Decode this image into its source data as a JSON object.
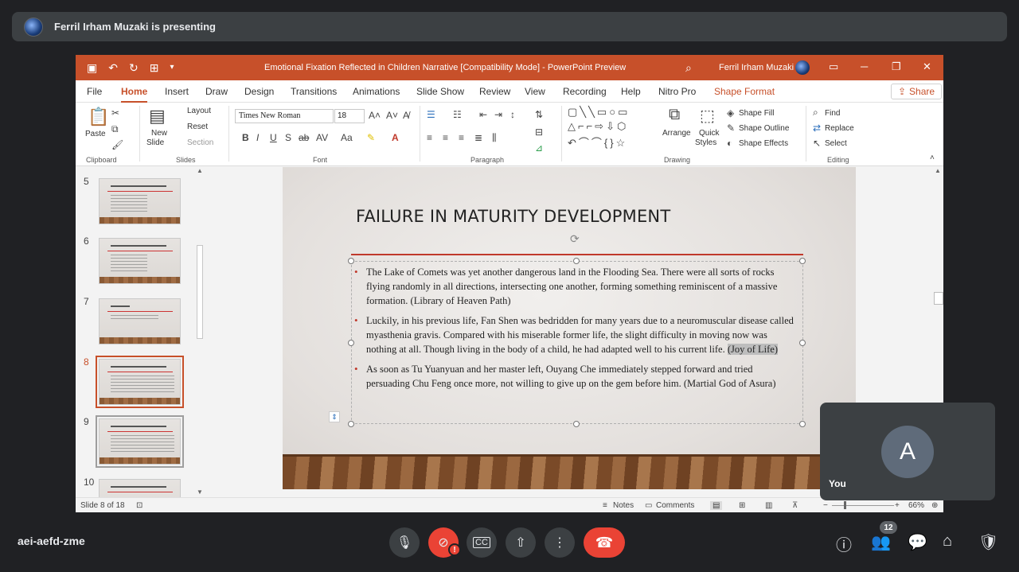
{
  "meet": {
    "presenter_banner": "Ferril Irham Muzaki is presenting",
    "meeting_code": "aei-aefd-zme",
    "self_avatar_letter": "A",
    "self_label": "You",
    "participants_count": "12",
    "alert_badge": "!"
  },
  "ppt": {
    "window_title": "Emotional Fixation Reflected in Children Narrative [Compatibility Mode] - PowerPoint Preview",
    "user_name": "Ferril Irham Muzaki",
    "tabs": [
      "File",
      "Home",
      "Insert",
      "Draw",
      "Design",
      "Transitions",
      "Animations",
      "Slide Show",
      "Review",
      "View",
      "Recording",
      "Help",
      "Nitro Pro",
      "Shape Format"
    ],
    "share_label": "Share",
    "ribbon": {
      "paste": "Paste",
      "new_slide_1": "New",
      "new_slide_2": "Slide",
      "layout": "Layout",
      "reset": "Reset",
      "section": "Section",
      "font_name": "Times New Roman",
      "font_size": "18",
      "arrange": "Arrange",
      "quick_styles_1": "Quick",
      "quick_styles_2": "Styles",
      "shape_fill": "Shape Fill",
      "shape_outline": "Shape Outline",
      "shape_effects": "Shape Effects",
      "find": "Find",
      "replace": "Replace",
      "select": "Select",
      "groups": {
        "clipboard": "Clipboard",
        "slides": "Slides",
        "font": "Font",
        "paragraph": "Paragraph",
        "drawing": "Drawing",
        "editing": "Editing"
      }
    },
    "thumbnails": [
      "5",
      "6",
      "7",
      "8",
      "9",
      "10"
    ],
    "slide": {
      "title": "FAILURE IN MATURITY DEVELOPMENT",
      "bullets": [
        {
          "text": "The Lake of Comets was yet another dangerous land in the Flooding Sea. There were all sorts of rocks flying randomly in all directions, intersecting one another, forming something reminiscent of a massive formation. (Library of Heaven Path)"
        },
        {
          "text": "Luckily, in his previous life, Fan Shen was bedridden for many years due to a neuromuscular disease called myasthenia gravis. Compared with his miserable former life, the slight difficulty in moving now was nothing at all. Though living in the body of a child, he had adapted well to his current life. ",
          "highlight": "(Joy of Life)"
        },
        {
          "text": "As soon as Tu Yuanyuan and her master left, Ouyang Che immediately stepped forward and tried persuading Chu Feng once more, not willing to give up on the gem before him. (Martial God of Asura)"
        }
      ]
    },
    "status": {
      "slide_of": "Slide 8 of 18",
      "notes": "Notes",
      "comments": "Comments",
      "zoom": "66%"
    }
  }
}
